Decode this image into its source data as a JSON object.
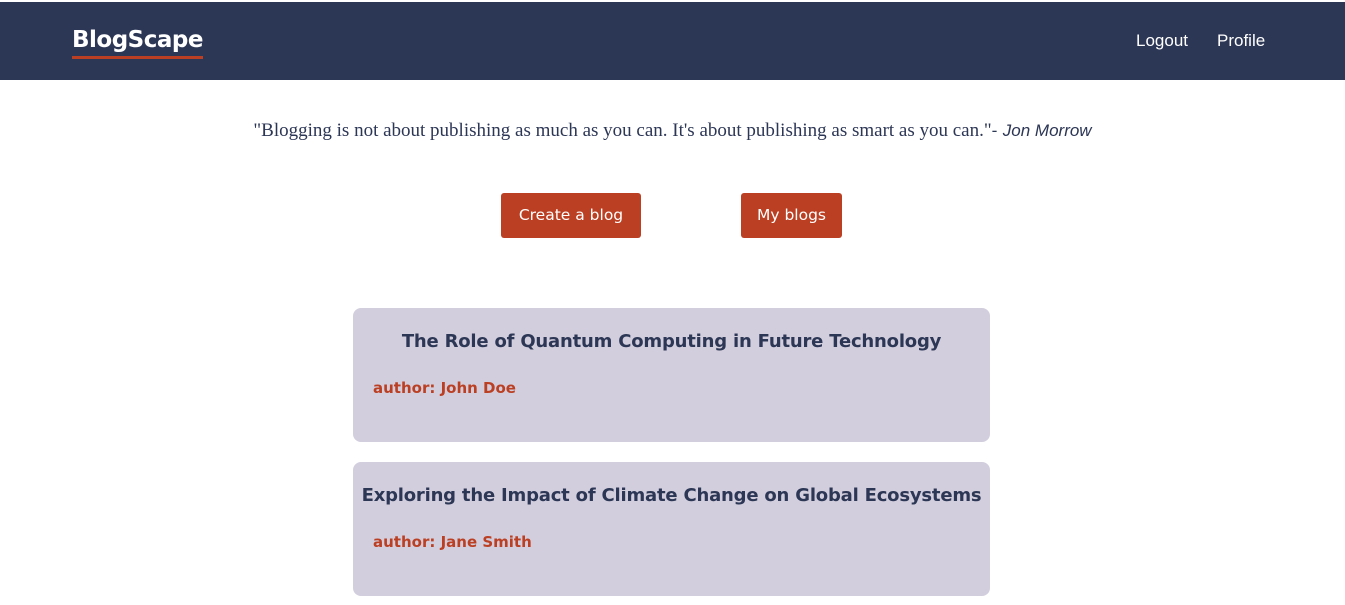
{
  "navbar": {
    "brand": "BlogScape",
    "links": [
      {
        "label": "Logout"
      },
      {
        "label": "Profile"
      }
    ]
  },
  "quote": {
    "text": "\"Blogging is not about publishing as much as you can. It's about publishing as smart as you can.\"",
    "separator": "- ",
    "author": "Jon Morrow"
  },
  "actions": {
    "create_label": "Create a blog",
    "my_blogs_label": "My blogs"
  },
  "blogs": [
    {
      "title": "The Role of Quantum Computing in Future Technology",
      "author": "author: John Doe"
    },
    {
      "title": "Exploring the Impact of Climate Change on Global Ecosystems",
      "author": "author: Jane Smith"
    }
  ],
  "colors": {
    "navbar_bg": "#2c3655",
    "accent": "#bb3f22",
    "card_bg": "#d2cedd"
  }
}
